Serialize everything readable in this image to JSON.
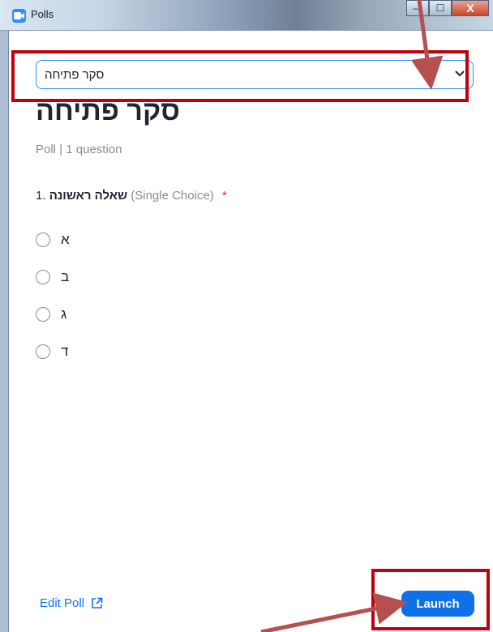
{
  "window": {
    "title": "Polls",
    "minimize": "—",
    "maximize": "☐",
    "close": "X"
  },
  "poll_select": {
    "value": "סקר פתיחה"
  },
  "poll": {
    "title": "סקר פתיחה",
    "meta": "Poll  |  1 question",
    "question": {
      "number": "1.",
      "text": "שאלה ראשונה",
      "type": "(Single Choice)",
      "required": "*"
    },
    "options": [
      {
        "label": "א"
      },
      {
        "label": "ב"
      },
      {
        "label": "ג"
      },
      {
        "label": "ד"
      }
    ]
  },
  "footer": {
    "edit_label": "Edit Poll",
    "launch_label": "Launch"
  },
  "colors": {
    "accent": "#0e71eb",
    "annotation": "#c0000e",
    "arrow": "#b5504f"
  }
}
